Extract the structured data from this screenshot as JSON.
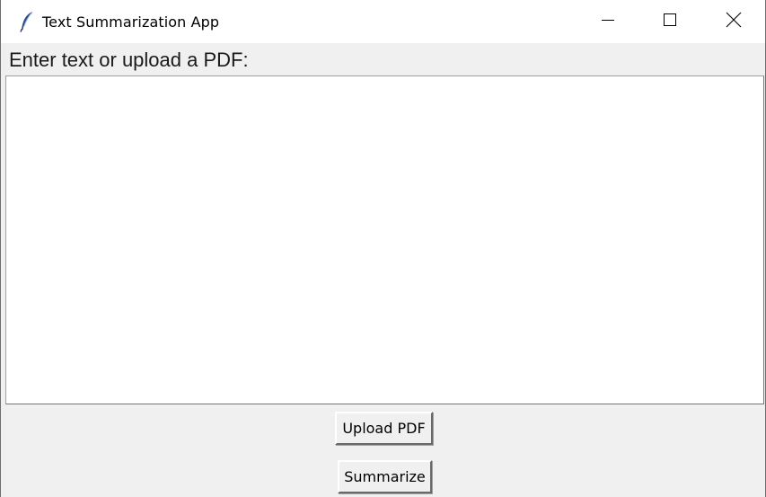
{
  "window": {
    "title": "Text Summarization App",
    "icon": "feather-icon",
    "controls": {
      "minimize_icon": "minimize-icon",
      "maximize_icon": "maximize-icon",
      "close_icon": "close-icon"
    }
  },
  "form": {
    "prompt_label": "Enter text or upload a PDF:",
    "text_value": ""
  },
  "buttons": {
    "upload_label": "Upload PDF",
    "summarize_label": "Summarize"
  },
  "colors": {
    "window_bg": "#f0f0f0",
    "titlebar_bg": "#ffffff",
    "textbox_bg": "#ffffff"
  }
}
